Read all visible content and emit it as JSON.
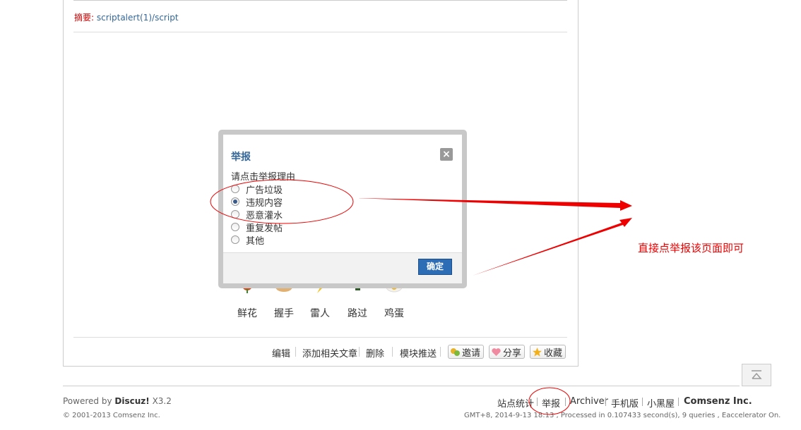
{
  "article": {
    "summary_label": "摘要",
    "summary_sep": ":",
    "summary_value": "scriptalert(1)/script"
  },
  "reactions": [
    {
      "label": "鲜花",
      "icon": "flower-icon"
    },
    {
      "label": "握手",
      "icon": "handshake-icon"
    },
    {
      "label": "雷人",
      "icon": "lightning-icon"
    },
    {
      "label": "路过",
      "icon": "passerby-icon"
    },
    {
      "label": "鸡蛋",
      "icon": "egg-icon"
    }
  ],
  "actions": {
    "edit": "编辑",
    "add_related": "添加相关文章",
    "delete": "删除",
    "push_module": "模块推送",
    "invite": "邀请",
    "share": "分享",
    "favorite": "收藏"
  },
  "dialog": {
    "title": "举报",
    "close": "×",
    "prompt": "请点击举报理由",
    "options": [
      {
        "label": "广告垃圾",
        "checked": false
      },
      {
        "label": "违规内容",
        "checked": true
      },
      {
        "label": "恶意灌水",
        "checked": false
      },
      {
        "label": "重复发帖",
        "checked": false
      },
      {
        "label": "其他",
        "checked": false
      }
    ],
    "confirm": "确定"
  },
  "annotation": "直接点举报该页面即可",
  "footer": {
    "powered_prefix": "Powered by",
    "brand": "Discuz!",
    "version": "X3.2",
    "copyright": "© 2001-2013 Comsenz Inc.",
    "links": [
      "站点统计",
      "举报",
      "Archiver",
      "手机版",
      "小黑屋"
    ],
    "company": "Comsenz Inc.",
    "gmt": "GMT+8, 2014-9-13 18:13 , Processed in 0.107433 second(s), 9 queries , Eaccelerator On."
  },
  "colors": {
    "annotation_red": "#ee0000",
    "dialog_title": "#336699",
    "button_blue": "#2c6db5"
  }
}
